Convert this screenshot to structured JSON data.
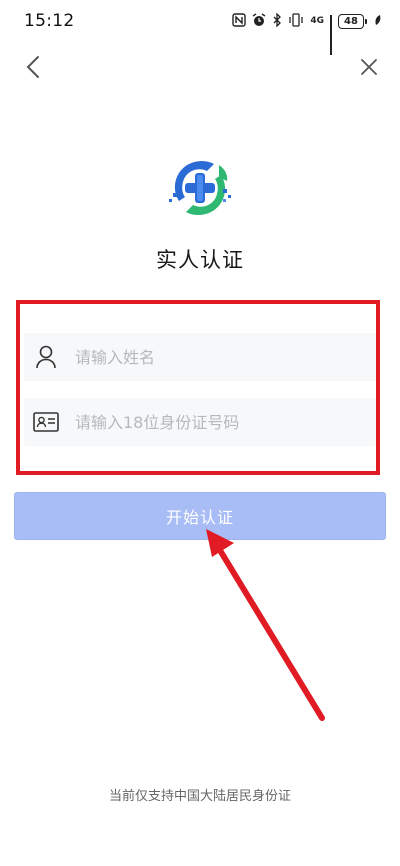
{
  "status_bar": {
    "time": "15:12",
    "network_type": "4G",
    "battery_level": "48",
    "icons": [
      "nfc-icon",
      "alarm-icon",
      "bluetooth-icon",
      "vibrate-icon",
      "signal-icon",
      "battery-icon",
      "leaf-icon"
    ]
  },
  "navigation": {
    "back_icon": "chevron-left-icon",
    "close_icon": "close-icon"
  },
  "page": {
    "logo_icon": "medical-cross-logo-icon",
    "title": "实人认证"
  },
  "form": {
    "name_field": {
      "icon": "person-icon",
      "placeholder": "请输入姓名",
      "value": ""
    },
    "id_field": {
      "icon": "id-card-icon",
      "placeholder": "请输入18位身份证号码",
      "value": ""
    }
  },
  "start_button": {
    "label": "开始认证"
  },
  "footer": {
    "note": "当前仅支持中国大陆居民身份证"
  },
  "colors": {
    "highlight": "#e01b24",
    "button_bg": "#a8bdf6",
    "logo_blue": "#2a6bd6",
    "logo_green": "#2fb872"
  }
}
